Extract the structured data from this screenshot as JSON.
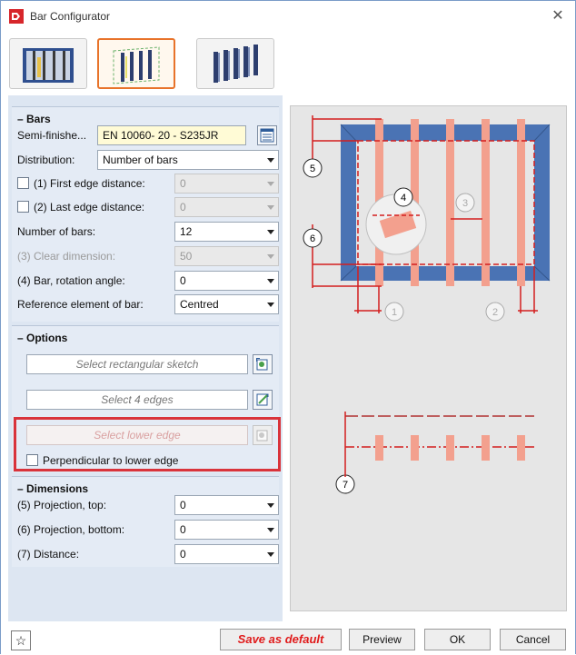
{
  "window": {
    "title": "Bar Configurator",
    "close_glyph": "✕"
  },
  "toolbar": {
    "buttons": [
      {
        "name": "mode-frame",
        "icon": "frame-bars-icon",
        "active": false
      },
      {
        "name": "mode-bars-in-frame",
        "icon": "bars-in-frame-icon",
        "active": true
      },
      {
        "name": "mode-bars-array",
        "icon": "bars-array-icon",
        "active": false
      }
    ]
  },
  "bars": {
    "title": "Bars",
    "semi_finished_label": "Semi-finishe...",
    "semi_finished_value": "EN 10060- 20 - S235JR",
    "distribution_label": "Distribution:",
    "distribution_value": "Number of bars",
    "first_edge_label": "(1) First edge distance:",
    "first_edge_value": "0",
    "last_edge_label": "(2) Last edge distance:",
    "last_edge_value": "0",
    "number_of_bars_label": "Number of bars:",
    "number_of_bars_value": "12",
    "clear_dimension_label": "(3) Clear dimension:",
    "clear_dimension_value": "50",
    "rotation_label": "(4) Bar, rotation angle:",
    "rotation_value": "0",
    "reference_label": "Reference element of bar:",
    "reference_value": "Centred"
  },
  "options": {
    "title": "Options",
    "select_sketch_placeholder": "Select rectangular sketch",
    "select_edges_placeholder": "Select 4 edges",
    "select_lower_edge_placeholder": "Select lower edge",
    "perpendicular_label": "Perpendicular to lower edge"
  },
  "dimensions": {
    "title": "Dimensions",
    "proj_top_label": "(5) Projection, top:",
    "proj_top_value": "0",
    "proj_bottom_label": "(6) Projection, bottom:",
    "proj_bottom_value": "0",
    "distance_label": "(7) Distance:",
    "distance_value": "0"
  },
  "preview": {
    "callouts": [
      "1",
      "2",
      "3",
      "4",
      "5",
      "6",
      "7"
    ]
  },
  "footer": {
    "save_default_label": "Save as default",
    "preview_label": "Preview",
    "ok_label": "OK",
    "cancel_label": "Cancel",
    "star_glyph": "☆"
  },
  "colors": {
    "frame_blue": "#4a73b4",
    "bar_salmon": "#f3a08e",
    "dim_red": "#d41e1e",
    "highlight_red": "#d9333b",
    "active_orange": "#e8732a"
  }
}
